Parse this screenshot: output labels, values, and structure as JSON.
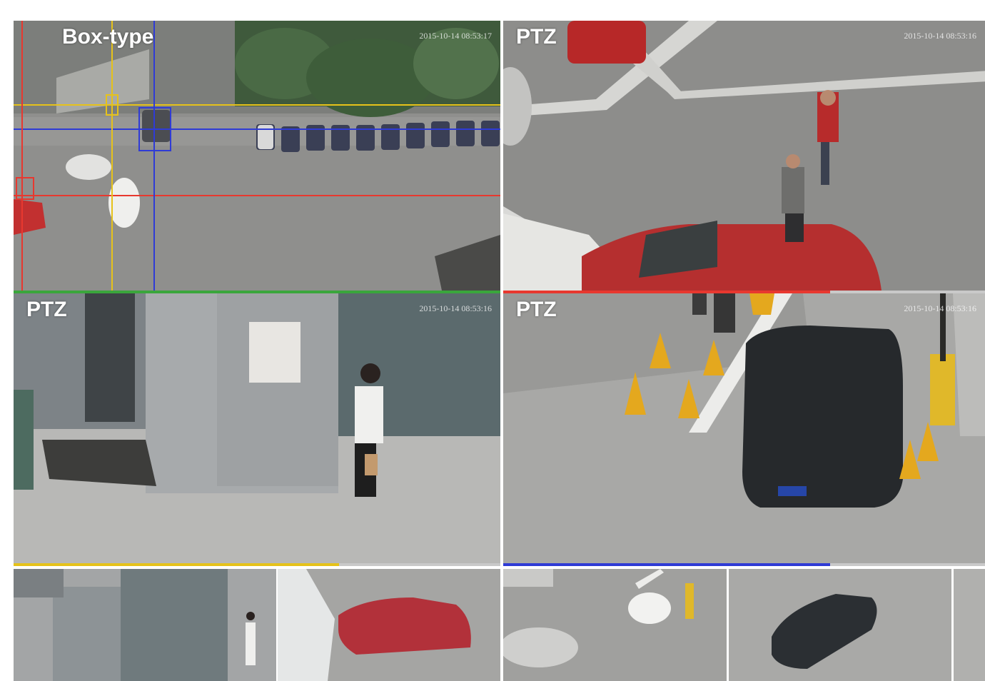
{
  "tiles": {
    "box": {
      "label": "Box-type",
      "timestamp": "2015-10-14 08:53:17"
    },
    "ptz_top_right": {
      "label": "PTZ",
      "timestamp": "2015-10-14 08:53:16"
    },
    "ptz_mid_left": {
      "label": "PTZ",
      "timestamp": "2015-10-14 08:53:16"
    },
    "ptz_mid_right": {
      "label": "PTZ",
      "timestamp": "2015-10-14 08:53:16"
    }
  },
  "colors": {
    "guide_red": "#e8382f",
    "guide_yellow": "#e6c21a",
    "guide_blue": "#2f3bd6",
    "bar_green": "#3aa63c",
    "bar_red": "#e8382f",
    "bar_yellow": "#e6c21a",
    "bar_blue": "#2f3bd6"
  }
}
